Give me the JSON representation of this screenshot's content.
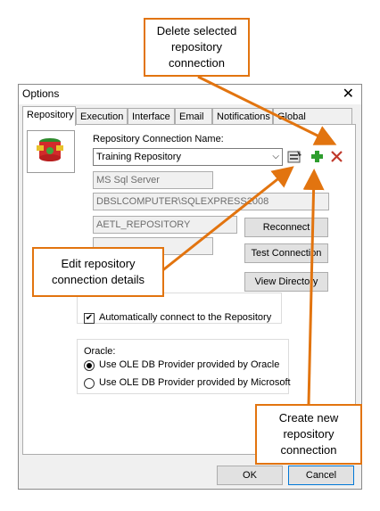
{
  "dialog": {
    "title": "Options"
  },
  "tabs": [
    {
      "label": "Repository"
    },
    {
      "label": "Execution"
    },
    {
      "label": "Interface"
    },
    {
      "label": "Email"
    },
    {
      "label": "Notifications"
    },
    {
      "label": "Global Variables"
    }
  ],
  "repository": {
    "connection_label": "Repository Connection Name:",
    "connection_value": "Training Repository",
    "server_type": "MS Sql Server",
    "server_name": "DBSLCOMPUTER\\SQLEXPRESS2008",
    "database": "AETL_REPOSITORY",
    "user": "",
    "reconnect_label": "Reconnect",
    "test_connection_label": "Test Connection",
    "view_directory_label": "View Directory",
    "auto_connect_label": "Automatically connect to the Repository",
    "auto_connect_checked": true
  },
  "oracle": {
    "group_label": "Oracle:",
    "option1": "Use OLE DB Provider provided by Oracle",
    "option2": "Use OLE DB Provider provided by Microsoft",
    "selected": 1
  },
  "buttons": {
    "ok": "OK",
    "cancel": "Cancel"
  },
  "callouts": {
    "delete": [
      "Delete selected",
      "repository",
      "connection"
    ],
    "edit": [
      "Edit repository",
      "connection details"
    ],
    "create": [
      "Create new",
      "repository",
      "connection"
    ]
  },
  "colors": {
    "callout_border": "#e2740f",
    "delete_icon": "#c0392b",
    "add_icon": "#2e9d2e"
  }
}
